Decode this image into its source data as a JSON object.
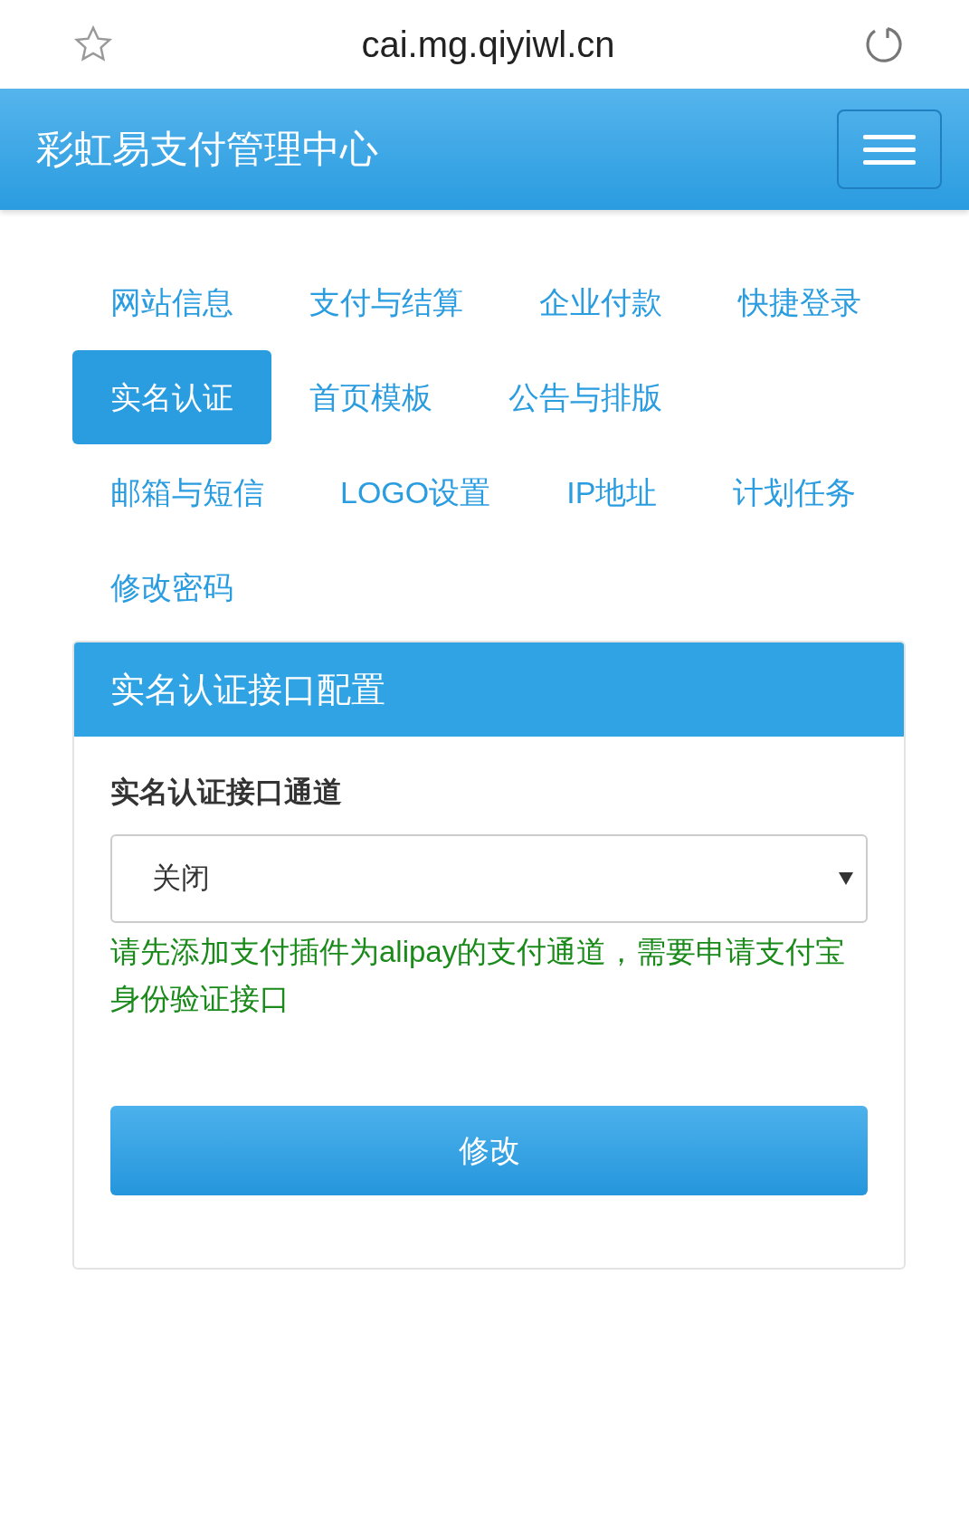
{
  "browser_bar": {
    "url": "cai.mg.qiyiwl.cn"
  },
  "navbar": {
    "title": "彩虹易支付管理中心"
  },
  "tabs": [
    {
      "label": "网站信息",
      "selected": false
    },
    {
      "label": "支付与结算",
      "selected": false
    },
    {
      "label": "企业付款",
      "selected": false
    },
    {
      "label": "快捷登录",
      "selected": false
    },
    {
      "label": "实名认证",
      "selected": true
    },
    {
      "label": "首页模板",
      "selected": false
    },
    {
      "label": "公告与排版",
      "selected": false
    },
    {
      "label": "邮箱与短信",
      "selected": false
    },
    {
      "label": "LOGO设置",
      "selected": false
    },
    {
      "label": "IP地址",
      "selected": false
    },
    {
      "label": "计划任务",
      "selected": false
    },
    {
      "label": "修改密码",
      "selected": false
    }
  ],
  "panel": {
    "title": "实名认证接口配置",
    "field_label": "实名认证接口通道",
    "select_value": "关闭",
    "help_text": "请先添加支付插件为alipay的支付通道，需要申请支付宝身份验证接口",
    "submit": "修改"
  }
}
